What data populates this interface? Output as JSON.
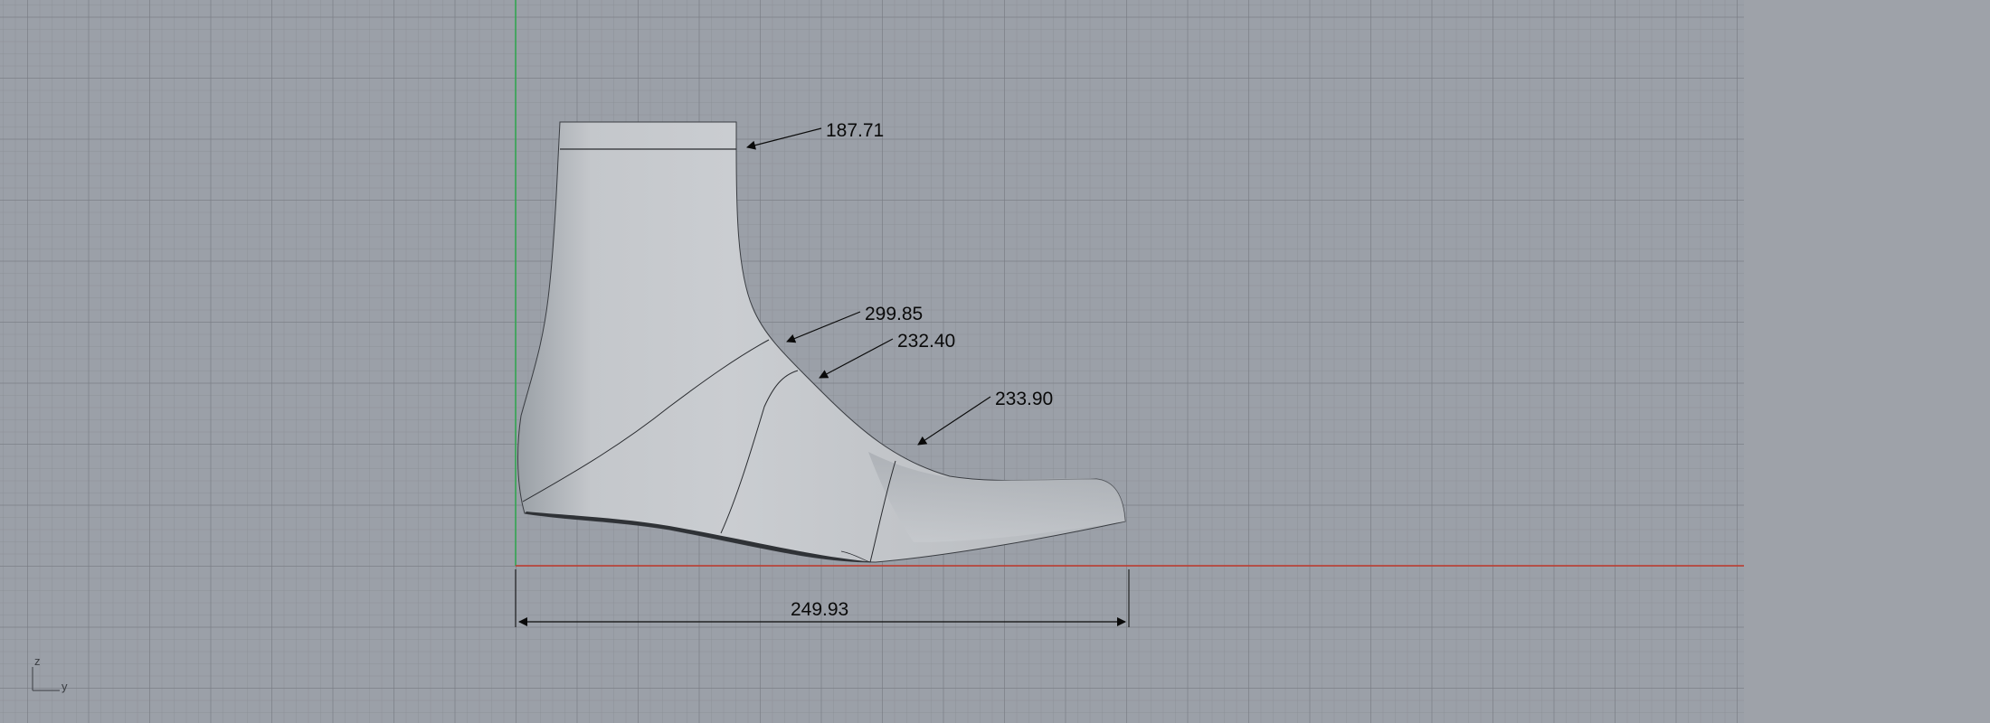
{
  "viewport": {
    "dimensions": {
      "top_opening": "187.71",
      "instep": "299.85",
      "waist": "232.40",
      "ball": "233.90",
      "length": "249.93"
    },
    "axis_labels": {
      "vertical": "z",
      "horizontal": "y"
    },
    "colors": {
      "x_axis_line": "#c0392b",
      "y_axis_line": "#2fa84f",
      "background": "#9ba0a8",
      "model_fill": "#c5c8cc"
    }
  }
}
